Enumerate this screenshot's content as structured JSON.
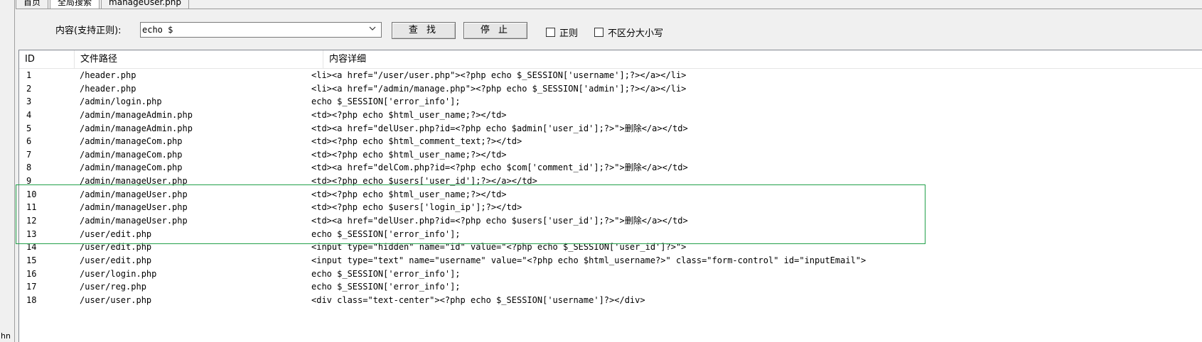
{
  "tabs": [
    {
      "label": "首页"
    },
    {
      "label": "全局搜索"
    },
    {
      "label": "manageUser.php"
    }
  ],
  "left_strip_text": "hn",
  "search": {
    "label": "内容(支持正则):",
    "value": "echo $",
    "search_button": "查 找",
    "stop_button": "停 止",
    "regex_label": "正则",
    "case_insensitive_label": "不区分大小写"
  },
  "table": {
    "columns": [
      "ID",
      "文件路径",
      "内容详细"
    ],
    "rows": [
      {
        "id": "1",
        "path": "/header.php",
        "detail": "<li><a href=\"/user/user.php\"><?php echo $_SESSION['username'];?></a></li>"
      },
      {
        "id": "2",
        "path": "/header.php",
        "detail": "<li><a href=\"/admin/manage.php\"><?php echo $_SESSION['admin'];?></a></li>"
      },
      {
        "id": "3",
        "path": "/admin/login.php",
        "detail": "echo $_SESSION['error_info'];"
      },
      {
        "id": "4",
        "path": "/admin/manageAdmin.php",
        "detail": "<td><?php echo $html_user_name;?></td>"
      },
      {
        "id": "5",
        "path": "/admin/manageAdmin.php",
        "detail": "<td><a href=\"delUser.php?id=<?php echo $admin['user_id'];?>\">删除</a></td>"
      },
      {
        "id": "6",
        "path": "/admin/manageCom.php",
        "detail": "<td><?php echo $html_comment_text;?></td>"
      },
      {
        "id": "7",
        "path": "/admin/manageCom.php",
        "detail": "<td><?php echo $html_user_name;?></td>"
      },
      {
        "id": "8",
        "path": "/admin/manageCom.php",
        "detail": "<td><a href=\"delCom.php?id=<?php echo $com['comment_id'];?>\">删除</a></td>"
      },
      {
        "id": "9",
        "path": "/admin/manageUser.php",
        "detail": "<td><?php echo $users['user_id'];?></a></td>"
      },
      {
        "id": "10",
        "path": "/admin/manageUser.php",
        "detail": "<td><?php echo $html_user_name;?></td>"
      },
      {
        "id": "11",
        "path": "/admin/manageUser.php",
        "detail": "<td><?php echo $users['login_ip'];?></td>"
      },
      {
        "id": "12",
        "path": "/admin/manageUser.php",
        "detail": "<td><a href=\"delUser.php?id=<?php echo $users['user_id'];?>\">删除</a></td>"
      },
      {
        "id": "13",
        "path": "/user/edit.php",
        "detail": "echo $_SESSION['error_info'];"
      },
      {
        "id": "14",
        "path": "/user/edit.php",
        "detail": "<input type=\"hidden\" name=\"id\" value=\"<?php echo $_SESSION['user_id']?>\">"
      },
      {
        "id": "15",
        "path": "/user/edit.php",
        "detail": "<input type=\"text\" name=\"username\" value=\"<?php echo $html_username?>\" class=\"form-control\" id=\"inputEmail\">"
      },
      {
        "id": "16",
        "path": "/user/login.php",
        "detail": "echo $_SESSION['error_info'];"
      },
      {
        "id": "17",
        "path": "/user/reg.php",
        "detail": "echo $_SESSION['error_info'];"
      },
      {
        "id": "18",
        "path": "/user/user.php",
        "detail": "<div class=\"text-center\"><?php echo $_SESSION['username']?></div>"
      }
    ]
  },
  "colors": {
    "highlight_border": "#22a04a",
    "window_bg": "#f0f0f0",
    "table_bg": "#ffffff"
  }
}
